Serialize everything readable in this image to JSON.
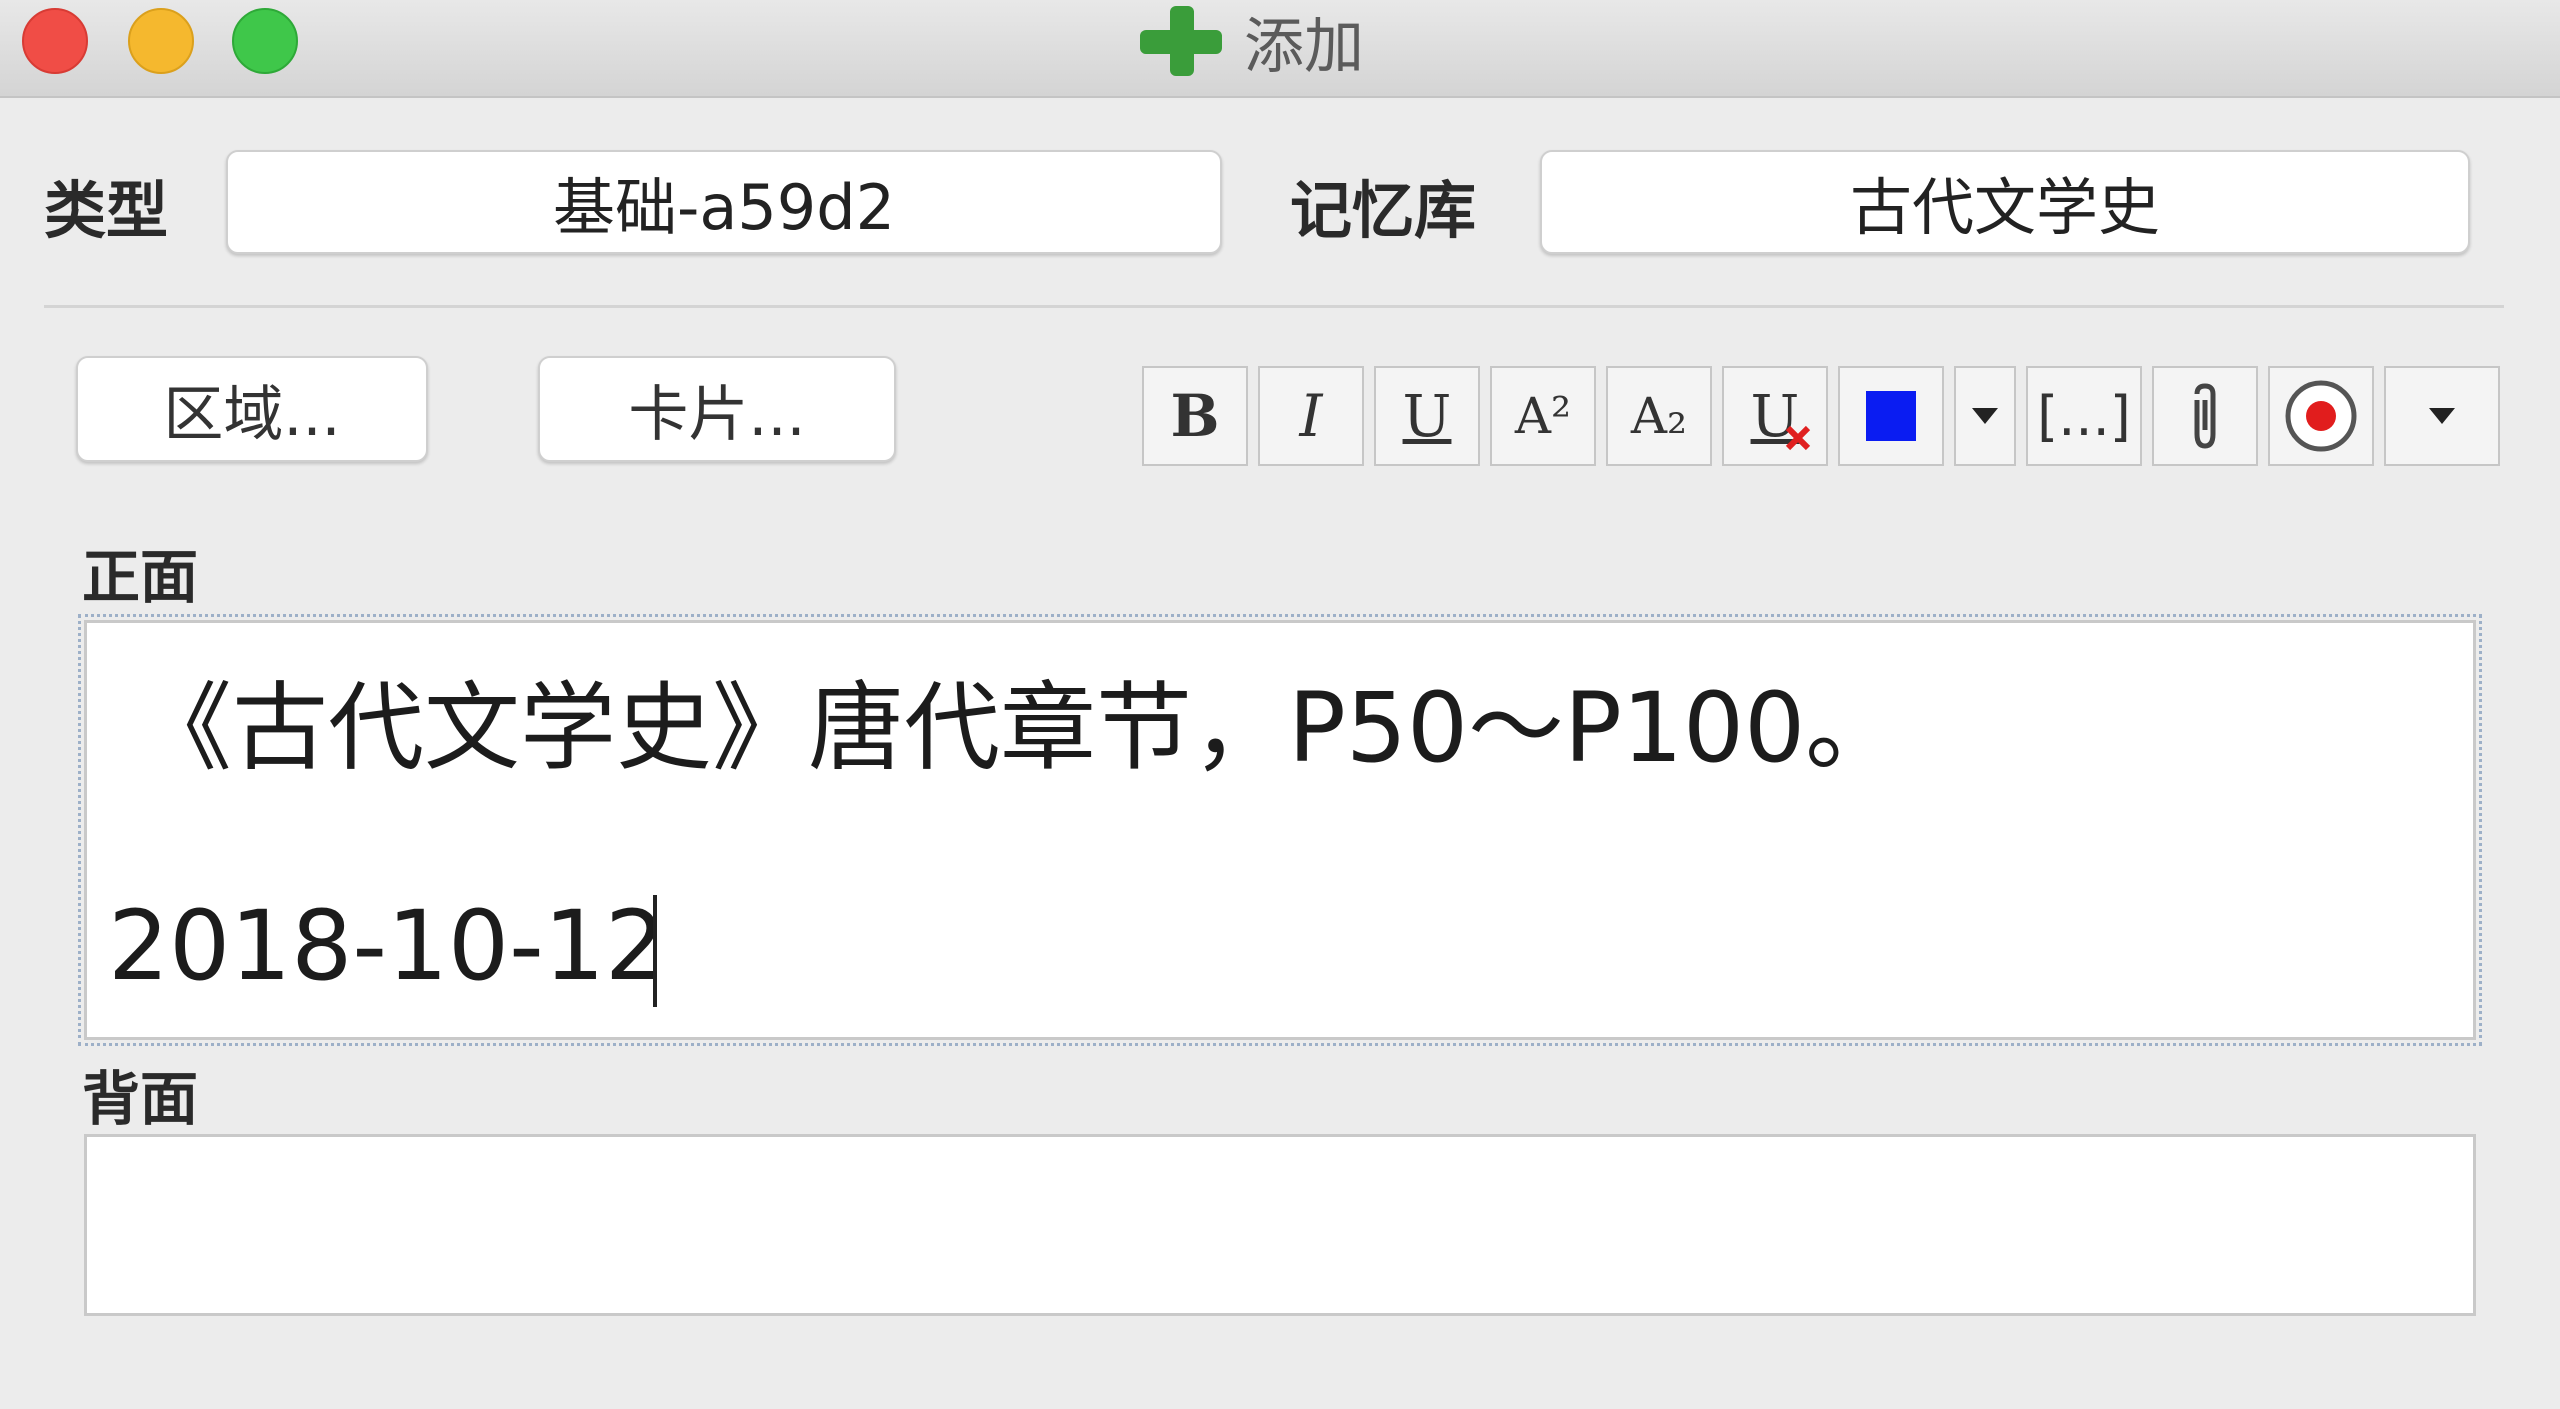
{
  "window": {
    "title": "添加"
  },
  "header": {
    "type_label": "类型",
    "type_value": "基础-a59d2",
    "deck_label": "记忆库",
    "deck_value": "古代文学史"
  },
  "buttons": {
    "fields": "区域...",
    "cards": "卡片..."
  },
  "toolbar": {
    "bold": "B",
    "italic": "I",
    "underline": "U",
    "superscript": "A²",
    "subscript": "A₂",
    "clear_format": "U",
    "color_swatch": "#0a1cf2",
    "cloze": "[...]"
  },
  "front": {
    "label": "正面",
    "line1": "《古代文学史》唐代章节，P50～P100。",
    "line2": "2018-10-12"
  },
  "back": {
    "label": "背面",
    "value": ""
  }
}
